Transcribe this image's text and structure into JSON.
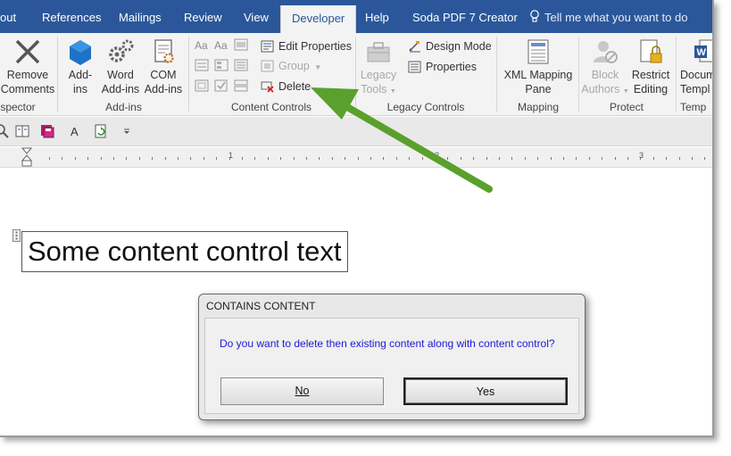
{
  "tabs": [
    {
      "label": "out",
      "active": false
    },
    {
      "label": "References",
      "active": false
    },
    {
      "label": "Mailings",
      "active": false
    },
    {
      "label": "Review",
      "active": false
    },
    {
      "label": "View",
      "active": false
    },
    {
      "label": "Developer",
      "active": true
    },
    {
      "label": "Help",
      "active": false
    },
    {
      "label": "Soda PDF 7 Creator",
      "active": false
    }
  ],
  "tell_me": "Tell me what you want to do",
  "ribbon": {
    "remove_comments": "Remove\nComments",
    "remove_comments_l1": "Remove",
    "remove_comments_l2": "Comments",
    "inspector_group": "spector",
    "addins_l1": "Add-",
    "addins_l2": "ins",
    "word_addins_l1": "Word",
    "word_addins_l2": "Add-ins",
    "com_addins_l1": "COM",
    "com_addins_l2": "Add-ins",
    "addins_group": "Add-ins",
    "edit_properties": "Edit Properties",
    "group": "Group",
    "delete": "Delete",
    "content_controls_group": "Content Controls",
    "legacy_tools_l1": "Legacy",
    "legacy_tools_l2": "Tools",
    "design_mode": "Design Mode",
    "properties": "Properties",
    "legacy_controls_group": "Legacy Controls",
    "xml_mapping_l1": "XML Mapping",
    "xml_mapping_l2": "Pane",
    "mapping_group": "Mapping",
    "block_authors_l1": "Block",
    "block_authors_l2": "Authors",
    "restrict_editing_l1": "Restrict",
    "restrict_editing_l2": "Editing",
    "protect_group": "Protect",
    "document_template_l1": "Docum",
    "document_template_l2": "Templ",
    "templates_group": "Temp"
  },
  "ruler": {
    "marks": [
      "1",
      "2",
      "3"
    ]
  },
  "document": {
    "content_control_text": "Some content control text"
  },
  "dialog": {
    "title": "CONTAINS CONTENT",
    "message": "Do you want to delete then existing content along with content control?",
    "no_label": "No",
    "yes_label": "Yes"
  },
  "colors": {
    "tab_bar": "#2b579a",
    "arrow": "#5aa02c",
    "dialog_message": "#1a1ad6"
  }
}
